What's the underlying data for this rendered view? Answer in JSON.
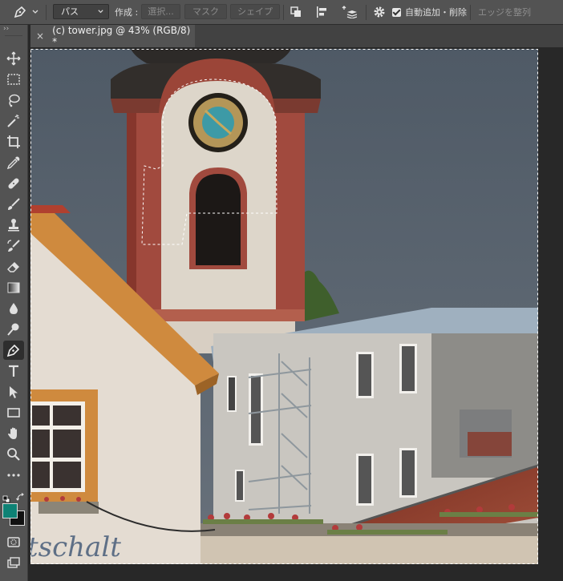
{
  "options_bar": {
    "tool_icon": "pen-icon",
    "mode_select": "パス",
    "make_label": "作成 :",
    "selection_button": "選択...",
    "mask_button": "マスク",
    "shape_button": "シェイプ",
    "auto_add_delete_label": "自動追加・削除",
    "auto_add_delete_checked": true,
    "align_edges_label": "エッジを整列"
  },
  "document_tab": {
    "close_symbol": "×",
    "title": "(c) tower.jpg @ 43% (RGB/8) *"
  },
  "toolbar": {
    "collapse_symbol": "››",
    "active_tool": "pen-tool",
    "tools": [
      "move-tool",
      "rectangular-marquee-tool",
      "lasso-tool",
      "magic-wand-tool",
      "crop-tool",
      "eyedropper-tool",
      "healing-brush-tool",
      "brush-tool",
      "clone-stamp-tool",
      "history-brush-tool",
      "eraser-tool",
      "gradient-tool",
      "blur-tool",
      "dodge-tool",
      "pen-tool",
      "type-tool",
      "path-selection-tool",
      "rectangle-tool",
      "hand-tool",
      "zoom-tool",
      "edit-toolbar",
      "default-colors",
      "swap-colors",
      "foreground-color",
      "background-color",
      "quick-mask",
      "screen-mode"
    ],
    "foreground_color": "#0e8275",
    "background_color": "#111111"
  },
  "canvas": {
    "image_text": "tschalt",
    "sky_color": "#58636f"
  }
}
